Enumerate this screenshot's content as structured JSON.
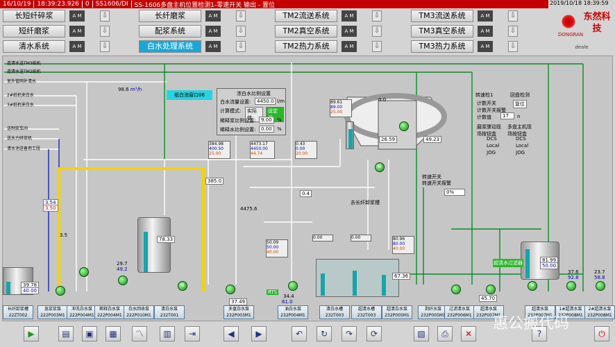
{
  "topbar": {
    "date": "16/10/19",
    "time": "18:39:23.926",
    "flag": "0",
    "tag": "SS1606/DI",
    "message": "SS-1606多盘主机位置检测1-零速开关  输出 - 置位"
  },
  "datetime": "2019/10/18 18:39:59",
  "logo": {
    "cn": "东然科技",
    "en": "DONGRAN"
  },
  "user": "deale",
  "menu": [
    {
      "label": "长短纤碎浆",
      "am": "A M",
      "active": false
    },
    {
      "label": "长纤磨浆",
      "am": "A M",
      "active": false
    },
    {
      "label": "TM2流送系统",
      "am": "A M",
      "active": false
    },
    {
      "label": "TM3流送系统",
      "am": "A M",
      "active": false
    },
    {
      "label": "短纤磨浆",
      "am": "A M",
      "active": false
    },
    {
      "label": "配浆系统",
      "am": "A M",
      "active": false
    },
    {
      "label": "TM2真空系统",
      "am": "A M",
      "active": false
    },
    {
      "label": "TM3真空系统",
      "am": "A M",
      "active": false
    },
    {
      "label": "清水系统",
      "am": "A M",
      "active": false
    },
    {
      "label": "白水处理系统",
      "am": "A M",
      "active": true
    },
    {
      "label": "TM2热力系统",
      "am": "A M",
      "active": false
    },
    {
      "label": "TM3热力系统",
      "am": "A M",
      "active": false
    }
  ],
  "left_labels": [
    "造清水送TM3纸机",
    "造清水送TM2纸机",
    "室外管网补清水",
    "2#纸机来白水",
    "3#纸机来白水",
    "送制浆车间",
    "送水力碎浆机",
    "清水池送备用工段"
  ],
  "cyan_label": "纸白池窗口06",
  "setpanel": {
    "title": "浓白水比例设置",
    "r1": "白水流量设置:",
    "r1v": "4450.0",
    "r1u": "l/m",
    "r2": "计算模式:",
    "r2a": "实际值",
    "r2b": "设定值",
    "r3": "稀释浆比例设置:",
    "r3v": "9.00",
    "r3u": "%",
    "r4": "稀释水比例设置:",
    "r4v": "0.00",
    "r4u": "%"
  },
  "values": {
    "v98": "98.6",
    "v98u": "m³/h",
    "v385": "385.0",
    "v4475": "4475.6",
    "v354": "3.54",
    "v350": "3.50",
    "v35": "3.5",
    "v3978": "39.78",
    "v4000": "40.00",
    "v297": "29.7",
    "v492": "49.2",
    "v7833": "78.33",
    "v3749": "37.49",
    "v344": "34.4",
    "v610": "61.0",
    "v00": "0.0",
    "v04": "0.4",
    "v2659": "26.59",
    "v4923": "49.23",
    "v6736": "67.36",
    "v4570": "45.70",
    "v8199": "81.99",
    "v5000": "50.00",
    "v376": "37.6",
    "v928": "92.8",
    "v237": "23.7",
    "v588": "58.8",
    "v0pct": "0%"
  },
  "infoboxes": [
    {
      "a": "384.98",
      "b": "400.50",
      "c": "25.00"
    },
    {
      "a": "4473.17",
      "b": "4450.00",
      "c": "44.74"
    },
    {
      "a": "0.43",
      "b": "0.00",
      "c": "20.00"
    },
    {
      "a": "89.61",
      "b": "89.00",
      "c": "25.00"
    },
    {
      "a": "50.09",
      "b": "50.00",
      "c": "40.00"
    },
    {
      "a": "80.96",
      "b": "80.00",
      "c": "40.00"
    },
    {
      "a": "0.00",
      "b": "0.00",
      "c": ""
    },
    {
      "a": "0.00",
      "b": "0.00",
      "c": ""
    }
  ],
  "rpanel": {
    "t1": "转速检1",
    "t2": "回盘检测",
    "r1": "计数开关",
    "r2": "计数开关报警",
    "r3": "计数值",
    "rv": "17",
    "ru": "n",
    "btn": "复位",
    "h1": "磨浆骤动现场按钮盒",
    "h2": "多盘主机现场按钮盒",
    "dcs": "DCS",
    "local": "Local",
    "jog": "JOG",
    "s1": "转速开关",
    "s2": "转速开关报警"
  },
  "bottom": [
    "长纤卸浆槽",
    "急浆浆泵",
    "冲洗白水泵",
    "稀释白水泵",
    "白水回收泵",
    "清白水泵",
    "多盘白水泵",
    "油白水泵",
    "清白水槽",
    "超清水槽",
    "超清白水泵",
    "剥纤水泵",
    "过滤清水泵",
    "超清水泵",
    "1#超清水泵",
    "2#超清水泵"
  ],
  "bottom_tags": [
    "22ZT002",
    "222P003M1",
    "222P004M1",
    "222P004M1",
    "222P010M1",
    "232T001",
    "232P003M1",
    "232P004M1",
    "232T003",
    "232T003",
    "232P005M1",
    "232P005M1",
    "232P006M1",
    "232P007M1",
    "232P008M1",
    "232P008M1"
  ],
  "rts": "RTS",
  "other": {
    "qv": "去长纤卸浆槽",
    "gl": "超清水过滤器"
  },
  "watermark": "惠公搬代码"
}
